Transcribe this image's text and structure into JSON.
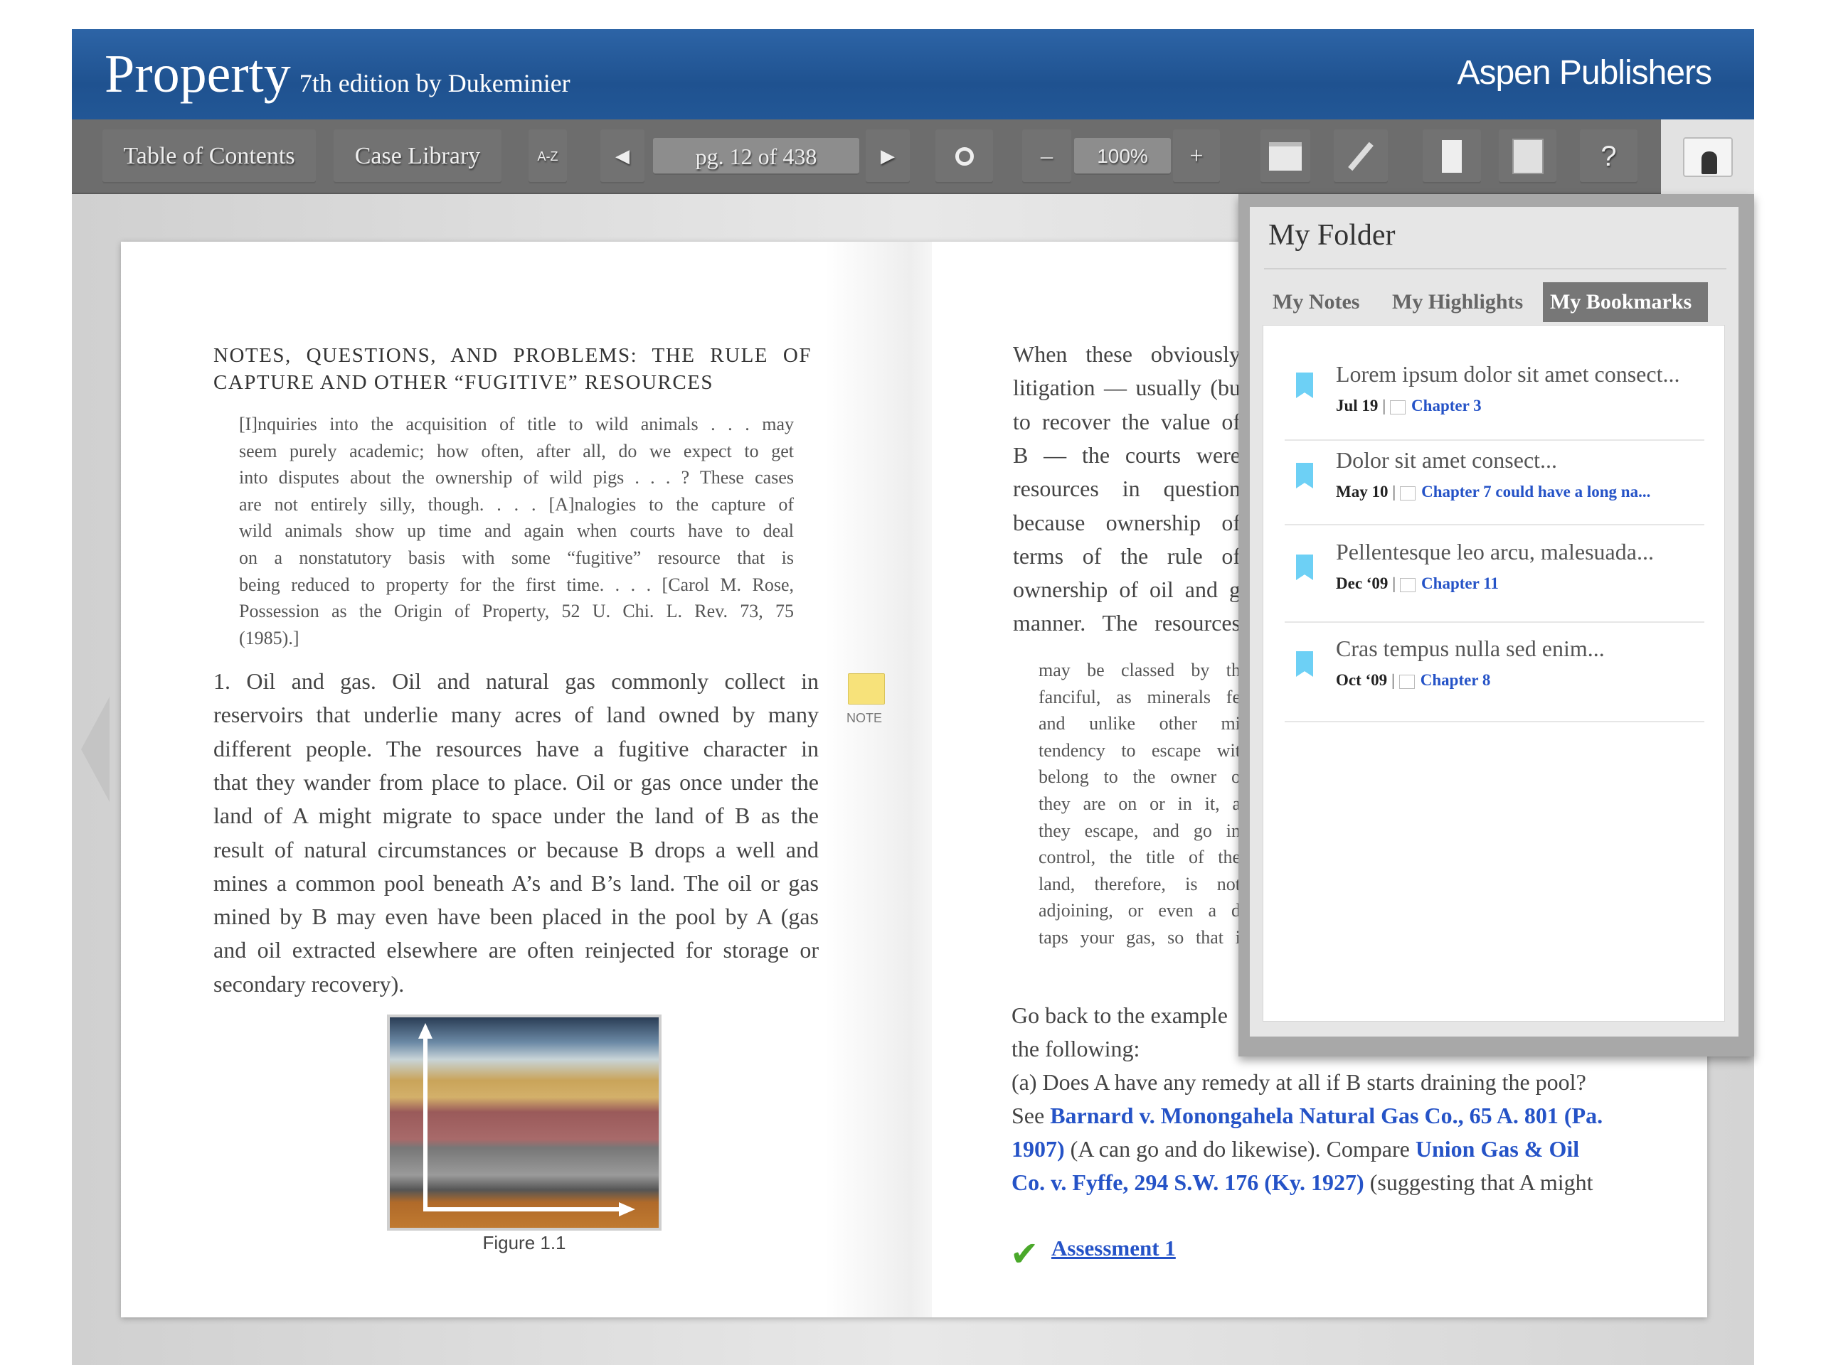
{
  "header": {
    "title": "Property",
    "subtitle": "7th edition by Dukeminier",
    "publisher": "Aspen Publishers"
  },
  "toolbar": {
    "toc": "Table of Contents",
    "case_library": "Case Library",
    "sort_icon": "A-Z",
    "page": "pg. 12 of 438",
    "zoom": "100%",
    "minus": "–",
    "plus": "+",
    "help": "?",
    "prev": "◀",
    "next": "▶"
  },
  "left_page": {
    "heading": [
      "NOTES, QUESTIONS, AND PROBLEMS: THE RULE OF",
      "CAPTURE AND OTHER “FUGITIVE” RESOURCES"
    ],
    "quote": [
      "[I]nquiries into the acquisition of title to wild animals . . . may",
      "seem purely academic; how often, after all, do we expect to get",
      "into disputes about the ownership of wild pigs . . . ? These cases",
      "are not entirely silly, though. . . . [A]nalogies to the capture of",
      "wild animals show up time and again when courts have to deal",
      "on a nonstatutory basis with some “fugitive” resource that is",
      "being reduced to property for the first time. . . . [Carol M. Rose,",
      "Possession as the Origin of Property, 52 U. Chi. L. Rev. 73, 75",
      "(1985).]"
    ],
    "body": [
      "1. Oil and gas. Oil and natural gas commonly collect in",
      "reservoirs that underlie many acres of land owned by many",
      "different people. The resources have a fugitive character in",
      "that they wander from place to place. Oil or gas once under the",
      "land of A might migrate to space under the land of B as the",
      "result of natural circumstances or because B drops a well and",
      "mines a common pool beneath A’s and B’s land. The oil or gas",
      "mined by B may even have been placed in the pool by A (gas",
      "and oil extracted elsewhere are often reinjected for storage or",
      "secondary recovery)."
    ],
    "note_label": "NOTE",
    "figure_caption": "Figure 1.1"
  },
  "right_page": {
    "body": [
      "When these obviously",
      "litigation — usually (bu",
      "to recover the value of",
      "B — the courts were",
      "resources in question",
      "because ownership of",
      "terms of the rule of",
      "ownership of oil and g",
      "manner. The resources"
    ],
    "quote": [
      "may be classed by th",
      "fanciful, as minerals fe",
      "and unlike other mi",
      "tendency to escape wit",
      "belong to the owner o",
      "they are on or in it, a",
      "they escape, and go in",
      "control, the title of the",
      "land, therefore, is not",
      "adjoining, or even a d",
      "taps your gas, so that i"
    ],
    "go_back": [
      "Go back to the example",
      "the following:"
    ],
    "question": "(a) Does A have any remedy at all if B starts draining the pool?",
    "see": "See ",
    "link1a": "Barnard v. Monongahela Natural Gas Co., 65 A. 801 (Pa.",
    "link1b": "1907)",
    "mid": " (A can go and do likewise). Compare ",
    "link2a": "Union Gas & Oil",
    "link2b": "Co. v. Fyffe, 294 S.W. 176 (Ky. 1927)",
    "tail": " (suggesting that A might",
    "assessment": "Assessment 1"
  },
  "folder": {
    "title": "My Folder",
    "tabs": [
      "My Notes",
      "My Highlights",
      "My Bookmarks"
    ],
    "active_tab": "My Bookmarks",
    "bookmarks": [
      {
        "title": "Lorem ipsum dolor sit amet consect...",
        "date": "Jul 19",
        "chapter": "Chapter 3"
      },
      {
        "title": "Dolor sit amet consect...",
        "date": "May 10",
        "chapter": "Chapter 7  could have a long na..."
      },
      {
        "title": "Pellentesque leo arcu, malesuada...",
        "date": "Dec ‘09",
        "chapter": "Chapter 11"
      },
      {
        "title": "Cras tempus nulla sed enim...",
        "date": "Oct ‘09",
        "chapter": "Chapter 8"
      }
    ]
  },
  "colors": {
    "header_blue": "#225796",
    "toolbar_gray": "#6d6d6d",
    "link_blue": "#2553c7",
    "bookmark_cyan": "#6dd0f5"
  }
}
